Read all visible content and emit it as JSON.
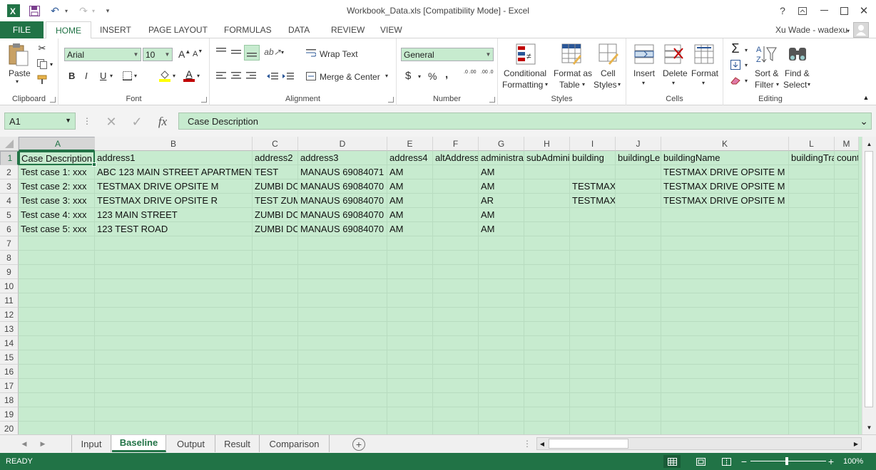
{
  "window": {
    "title": "Workbook_Data.xls  [Compatibility Mode] - Excel",
    "user": "Xu Wade - wadexu"
  },
  "ribbon_tabs": [
    "FILE",
    "HOME",
    "INSERT",
    "PAGE LAYOUT",
    "FORMULAS",
    "DATA",
    "REVIEW",
    "VIEW"
  ],
  "ribbon": {
    "clipboard": {
      "group": "Clipboard",
      "paste": "Paste"
    },
    "font": {
      "group": "Font",
      "name": "Arial",
      "size": "10",
      "bold": "B",
      "italic": "I",
      "underline": "U",
      "grow": "A",
      "shrink": "A",
      "color_a": "A"
    },
    "alignment": {
      "group": "Alignment",
      "wrap": "Wrap Text",
      "merge": "Merge & Center"
    },
    "number": {
      "group": "Number",
      "format": "General",
      "currency": "$",
      "percent": "%",
      "comma": ",",
      "inc_decimal": ".0 .00",
      "dec_decimal": ".00 .0"
    },
    "styles": {
      "group": "Styles",
      "conditional_1": "Conditional",
      "conditional_2": "Formatting",
      "format_table_1": "Format as",
      "format_table_2": "Table",
      "cell_styles_1": "Cell",
      "cell_styles_2": "Styles"
    },
    "cells": {
      "group": "Cells",
      "insert": "Insert",
      "delete": "Delete",
      "format": "Format"
    },
    "editing": {
      "group": "Editing",
      "sort_1": "Sort &",
      "sort_2": "Filter",
      "find_1": "Find &",
      "find_2": "Select"
    }
  },
  "formula_bar": {
    "name_box": "A1",
    "content": "Case Description",
    "fx": "fx"
  },
  "columns": [
    "A",
    "B",
    "C",
    "D",
    "E",
    "F",
    "G",
    "H",
    "I",
    "J",
    "K",
    "L",
    "M"
  ],
  "rows": [
    "1",
    "2",
    "3",
    "4",
    "5",
    "6",
    "7",
    "8",
    "9",
    "10",
    "11",
    "12",
    "13",
    "14",
    "15",
    "16",
    "17",
    "18",
    "19",
    "20"
  ],
  "cells": [
    [
      "Case Description",
      "address1",
      "address2",
      "address3",
      "address4",
      "altAddress",
      "administra",
      "subAdmini",
      "building",
      "buildingLe",
      "buildingName",
      "buildingTra",
      "count"
    ],
    [
      "Test case 1: xxx",
      "ABC 123 MAIN STREET APARTMEN",
      "TEST",
      "MANAUS 69084071",
      "AM",
      "",
      "AM",
      "",
      "",
      "",
      "TESTMAX DRIVE OPSITE M",
      "",
      ""
    ],
    [
      "Test case 2: xxx",
      "TESTMAX DRIVE OPSITE M",
      "ZUMBI DO",
      "MANAUS 69084070",
      "AM",
      "",
      "AM",
      "",
      "TESTMAX",
      "",
      "TESTMAX DRIVE OPSITE M",
      "",
      ""
    ],
    [
      "Test case 3: xxx",
      "TESTMAX DRIVE OPSITE R",
      "TEST ZUM",
      "MANAUS 69084070",
      "AM",
      "",
      "AR",
      "",
      "TESTMAX",
      "",
      "TESTMAX DRIVE OPSITE M",
      "",
      ""
    ],
    [
      "Test case 4: xxx",
      "123 MAIN STREET",
      "ZUMBI DO",
      "MANAUS 69084070",
      "AM",
      "",
      "AM",
      "",
      "",
      "",
      "",
      "",
      ""
    ],
    [
      "Test case 5: xxx",
      "123 TEST ROAD",
      "ZUMBI DO",
      "MANAUS 69084070",
      "AM",
      "",
      "AM",
      "",
      "",
      "",
      "",
      "",
      ""
    ]
  ],
  "sheets": [
    "Input",
    "Baseline",
    "Output",
    "Result",
    "Comparison"
  ],
  "active_sheet": "Baseline",
  "status": {
    "mode": "READY",
    "zoom": "100%"
  },
  "colors": {
    "accent": "#217346",
    "sheet_bg": "#c7ebcf"
  }
}
